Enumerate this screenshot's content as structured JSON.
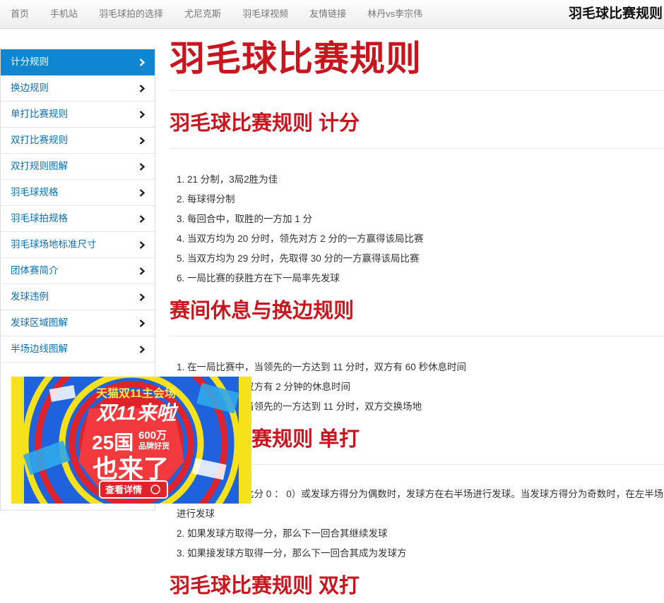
{
  "nav": {
    "links": [
      "首页",
      "手机站",
      "羽毛球拍的选择",
      "尤尼克斯",
      "羽毛球视频",
      "友情链接",
      "林丹vs李宗伟"
    ],
    "brand": "羽毛球比赛规则"
  },
  "sidebar": {
    "items": [
      {
        "label": "计分规则",
        "active": true
      },
      {
        "label": "换边规则"
      },
      {
        "label": "单打比赛规则"
      },
      {
        "label": "双打比赛规则"
      },
      {
        "label": "双打规则图解"
      },
      {
        "label": "羽毛球规格"
      },
      {
        "label": "羽毛球拍规格"
      },
      {
        "label": "羽毛球场地标准尺寸"
      },
      {
        "label": "团体赛简介"
      },
      {
        "label": "发球违例"
      },
      {
        "label": "发球区域图解"
      },
      {
        "label": "半场边线图解"
      }
    ]
  },
  "ad": {
    "line1": "天猫双11主会场",
    "line2": "双11来啦",
    "line3": "25国",
    "line4": "600万",
    "line5": "品牌好货",
    "line6": "也来了",
    "button": "查看详情"
  },
  "main": {
    "title": "羽毛球比赛规则",
    "sections": [
      {
        "heading": "羽毛球比赛规则 计分",
        "items": [
          "1. 21 分制，3局2胜为佳",
          "2. 每球得分制",
          "3. 每回合中，取胜的一方加 1 分",
          "4. 当双方均为 20 分时，领先对方 2 分的一方赢得该局比赛",
          "5. 当双方均为 29 分时，先取得 30 分的一方赢得该局比赛",
          "6. 一局比赛的获胜方在下一局率先发球"
        ]
      },
      {
        "heading": "赛间休息与换边规则",
        "items": [
          "1. 在一局比赛中，当领先的一方达到 11 分时，双方有 60 秒休息时间",
          "2. 局与局之间，双方有 2 分钟的休息时间",
          "3. 在第三局中，当领先的一方达到 11 分时，双方交换场地"
        ]
      },
      {
        "heading": "羽毛球比赛规则 单打",
        "items": [
          "1. 比赛开始时（比分 0 ： 0）或发球方得分为偶数时，发球方在右半场进行发球。当发球方得分为奇数时，在左半场进行发球",
          "2. 如果发球方取得一分，那么下一回合其继续发球",
          "3. 如果接发球方取得一分，那么下一回合其成为发球方"
        ]
      },
      {
        "heading": "羽毛球比赛规则 双打",
        "items": []
      }
    ]
  },
  "colors": {
    "accent_red": "#c9151e",
    "link_blue": "#0b6fb6",
    "active_blue": "#0f86d1"
  }
}
